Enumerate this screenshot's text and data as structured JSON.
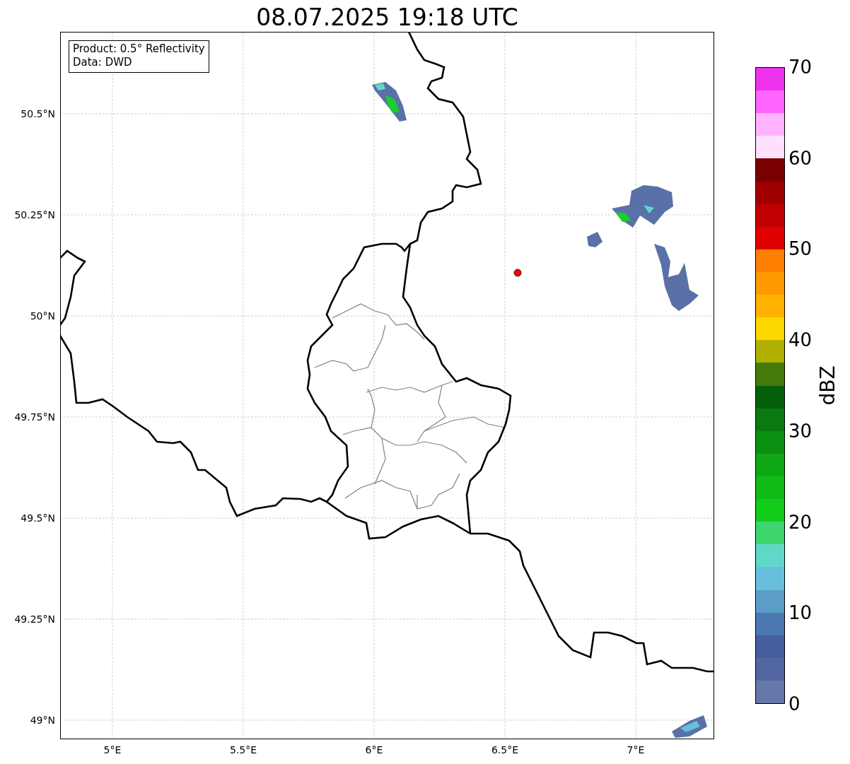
{
  "title": "08.07.2025 19:18 UTC",
  "info_box": {
    "lines": [
      "Product: 0.5° Reflectivity",
      "Data: DWD"
    ]
  },
  "map": {
    "lat_ticks": [
      "50.5°N",
      "50.25°N",
      "50°N",
      "49.75°N",
      "49.5°N",
      "49.25°N",
      "49°N"
    ],
    "lon_ticks": [
      "5°E",
      "5.5°E",
      "6°E",
      "6.5°E",
      "7°E"
    ]
  },
  "colorbar": {
    "label": "dBZ",
    "ticks": [
      "70",
      "60",
      "50",
      "40",
      "30",
      "20",
      "10",
      "0"
    ],
    "bins": [
      {
        "color": "#6677aa"
      },
      {
        "color": "#5266a0"
      },
      {
        "color": "#445ea0"
      },
      {
        "color": "#4a78b0"
      },
      {
        "color": "#5a9ec8"
      },
      {
        "color": "#66c0dd"
      },
      {
        "color": "#60d8c8"
      },
      {
        "color": "#3dd66e"
      },
      {
        "color": "#12cc1a"
      },
      {
        "color": "#10bb18"
      },
      {
        "color": "#0fa815"
      },
      {
        "color": "#0c9012"
      },
      {
        "color": "#0a7a10"
      },
      {
        "color": "#055e0a"
      },
      {
        "color": "#457a0a"
      },
      {
        "color": "#b0b000"
      },
      {
        "color": "#ffd700"
      },
      {
        "color": "#ffb300"
      },
      {
        "color": "#ff9900"
      },
      {
        "color": "#ff8000"
      },
      {
        "color": "#e00000"
      },
      {
        "color": "#c00000"
      },
      {
        "color": "#a00000"
      },
      {
        "color": "#7a0000"
      },
      {
        "color": "#ffe0ff"
      },
      {
        "color": "#ffb3ff"
      },
      {
        "color": "#ff66ff"
      },
      {
        "color": "#ee33ee"
      }
    ]
  }
}
